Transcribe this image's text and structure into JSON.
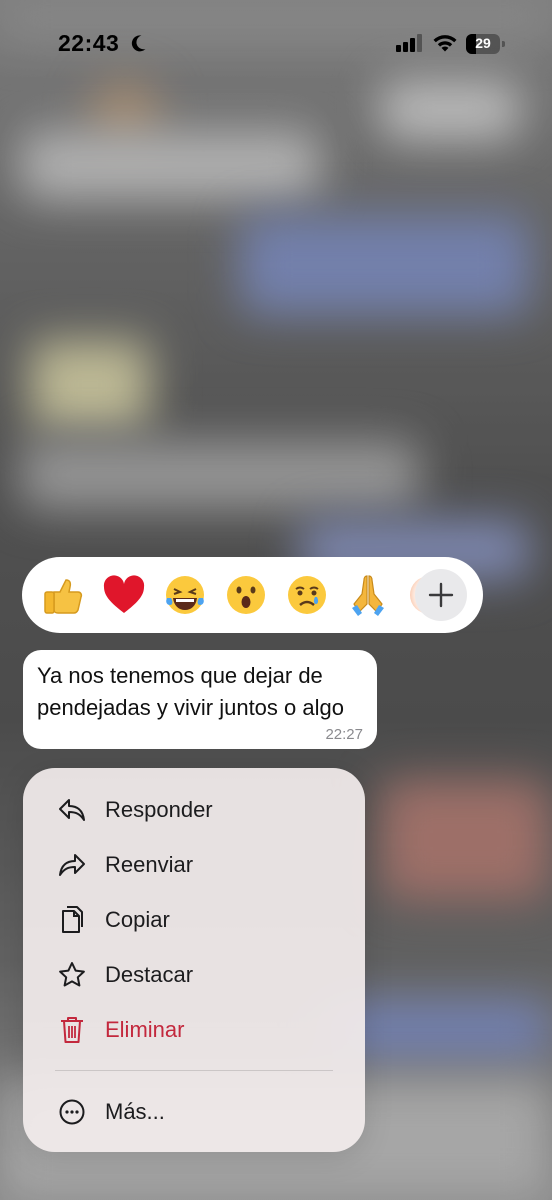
{
  "status_bar": {
    "time": "22:43",
    "battery": "29"
  },
  "reactions": {
    "emojis": [
      "👍",
      "❤️",
      "😂",
      "😮",
      "😢",
      "🙏",
      "😡"
    ],
    "more_label": "+"
  },
  "message": {
    "text": "Ya nos tenemos que dejar de pendejadas y vivir juntos o algo",
    "time": "22:27"
  },
  "menu": {
    "items": [
      {
        "label": "Responder",
        "icon": "reply-icon"
      },
      {
        "label": "Reenviar",
        "icon": "forward-icon"
      },
      {
        "label": "Copiar",
        "icon": "copy-icon"
      },
      {
        "label": "Destacar",
        "icon": "star-icon"
      },
      {
        "label": "Eliminar",
        "icon": "trash-icon"
      },
      {
        "label": "Más...",
        "icon": "more-icon"
      }
    ]
  },
  "colors": {
    "danger": "#c3283d",
    "menu_bg": "#f2ecec",
    "bubble_bg": "#ffffff"
  }
}
